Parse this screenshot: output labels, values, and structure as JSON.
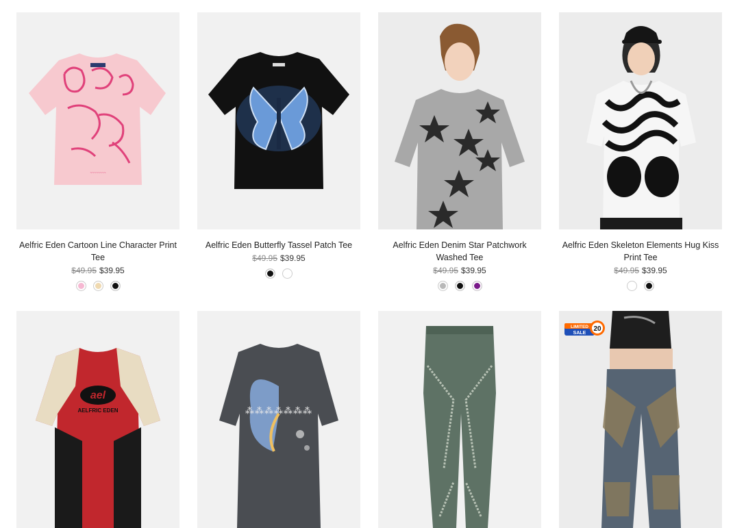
{
  "products": [
    {
      "name": "Aelfric Eden Cartoon Line Character Print Tee",
      "old_price": "$49.95",
      "price": "$39.95",
      "swatches": [
        "#f6b8d2",
        "#efd9b0",
        "#111111"
      ]
    },
    {
      "name": "Aelfric Eden Butterfly Tassel Patch Tee",
      "old_price": "$49.95",
      "price": "$39.95",
      "swatches": [
        "#111111",
        "#ffffff"
      ]
    },
    {
      "name": "Aelfric Eden Denim Star Patchwork Washed Tee",
      "old_price": "$49.95",
      "price": "$39.95",
      "swatches": [
        "#b8b8b8",
        "#111111",
        "#7a1a8a"
      ]
    },
    {
      "name": "Aelfric Eden Skeleton Elements Hug Kiss Print Tee",
      "old_price": "$49.95",
      "price": "$39.95",
      "swatches": [
        "#ffffff",
        "#111111"
      ]
    }
  ],
  "row2": {
    "shirt_logo": "ael",
    "shirt_brand": "AELFRIC EDEN",
    "badge_line1": "LIMITED",
    "badge_line2": "SALE",
    "badge_number": "20"
  }
}
